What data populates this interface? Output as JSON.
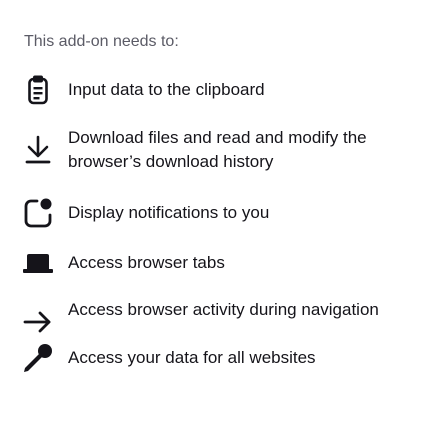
{
  "heading": "This add-on needs to:",
  "permissions": [
    {
      "icon": "clipboard-icon",
      "label": "Input data to the clipboard"
    },
    {
      "icon": "download-icon",
      "label": "Download files and read and modify the browser’s download history"
    },
    {
      "icon": "notification-icon",
      "label": "Display notifications to you"
    },
    {
      "icon": "tabs-icon",
      "label": "Access browser tabs"
    },
    {
      "icon": "arrow-right-icon",
      "label": "Access browser activity during navigation"
    },
    {
      "icon": "key-icon",
      "label": "Access your data for all websites"
    }
  ],
  "colors": {
    "text": "#15141a",
    "secondary_text": "#5b5b66",
    "background": "#ffffff"
  }
}
